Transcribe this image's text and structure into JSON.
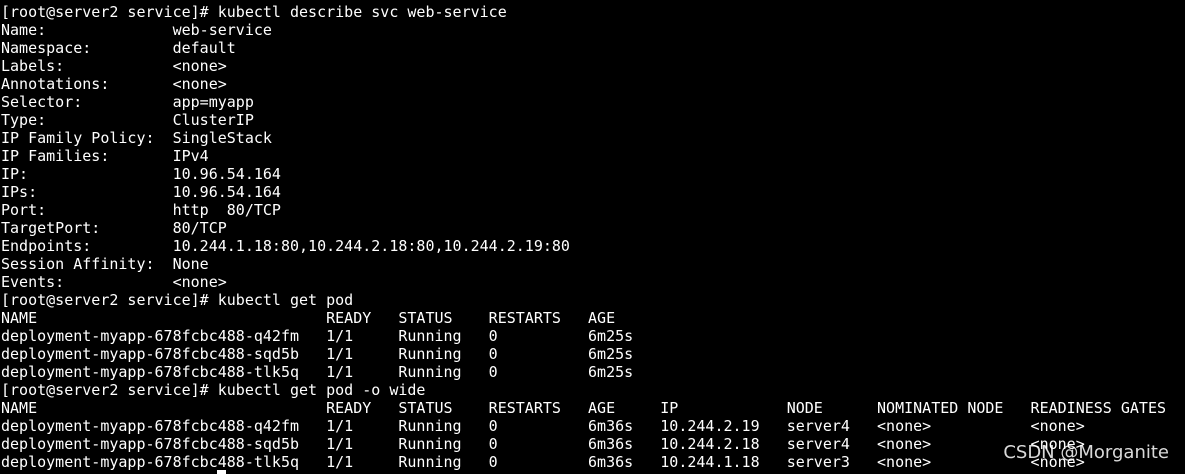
{
  "terminal": {
    "lines": [
      {
        "type": "prompt",
        "prompt": "[root@server2 service]# ",
        "command": "kubectl describe svc web-service"
      },
      {
        "type": "kv",
        "key": "Name:",
        "value": "web-service"
      },
      {
        "type": "kv",
        "key": "Namespace:",
        "value": "default"
      },
      {
        "type": "kv",
        "key": "Labels:",
        "value": "<none>"
      },
      {
        "type": "kv",
        "key": "Annotations:",
        "value": "<none>"
      },
      {
        "type": "kv",
        "key": "Selector:",
        "value": "app=myapp"
      },
      {
        "type": "kv",
        "key": "Type:",
        "value": "ClusterIP"
      },
      {
        "type": "kv",
        "key": "IP Family Policy:",
        "value": "SingleStack"
      },
      {
        "type": "kv",
        "key": "IP Families:",
        "value": "IPv4"
      },
      {
        "type": "kv",
        "key": "IP:",
        "value": "10.96.54.164"
      },
      {
        "type": "kv",
        "key": "IPs:",
        "value": "10.96.54.164"
      },
      {
        "type": "kv",
        "key": "Port:",
        "value": "http  80/TCP"
      },
      {
        "type": "kv",
        "key": "TargetPort:",
        "value": "80/TCP"
      },
      {
        "type": "kv",
        "key": "Endpoints:",
        "value": "10.244.1.18:80,10.244.2.18:80,10.244.2.19:80"
      },
      {
        "type": "kv",
        "key": "Session Affinity:",
        "value": "None"
      },
      {
        "type": "kv",
        "key": "Events:",
        "value": "<none>"
      },
      {
        "type": "prompt",
        "prompt": "[root@server2 service]# ",
        "command": "kubectl get pod"
      },
      {
        "type": "header",
        "cells": [
          "NAME",
          "READY",
          "STATUS",
          "RESTARTS",
          "AGE"
        ]
      },
      {
        "type": "row",
        "cells": [
          "deployment-myapp-678fcbc488-q42fm",
          "1/1",
          "Running",
          "0",
          "6m25s"
        ]
      },
      {
        "type": "row",
        "cells": [
          "deployment-myapp-678fcbc488-sqd5b",
          "1/1",
          "Running",
          "0",
          "6m25s"
        ]
      },
      {
        "type": "row",
        "cells": [
          "deployment-myapp-678fcbc488-tlk5q",
          "1/1",
          "Running",
          "0",
          "6m25s"
        ]
      },
      {
        "type": "prompt",
        "prompt": "[root@server2 service]# ",
        "command": "kubectl get pod -o wide"
      },
      {
        "type": "header",
        "cells": [
          "NAME",
          "READY",
          "STATUS",
          "RESTARTS",
          "AGE",
          "IP",
          "NODE",
          "NOMINATED NODE",
          "READINESS GATES"
        ]
      },
      {
        "type": "row",
        "cells": [
          "deployment-myapp-678fcbc488-q42fm",
          "1/1",
          "Running",
          "0",
          "6m36s",
          "10.244.2.19",
          "server4",
          "<none>",
          "<none>"
        ]
      },
      {
        "type": "row",
        "cells": [
          "deployment-myapp-678fcbc488-sqd5b",
          "1/1",
          "Running",
          "0",
          "6m36s",
          "10.244.2.18",
          "server4",
          "<none>",
          "<none>"
        ]
      },
      {
        "type": "row",
        "cells": [
          "deployment-myapp-678fcbc488-tlk5q",
          "1/1",
          "Running",
          "0",
          "6m36s",
          "10.244.1.18",
          "server3",
          "<none>",
          "<none>"
        ]
      }
    ]
  },
  "watermark": "CSDN @Morganite",
  "colors": {
    "background": "#000000",
    "text": "#ffffff"
  }
}
